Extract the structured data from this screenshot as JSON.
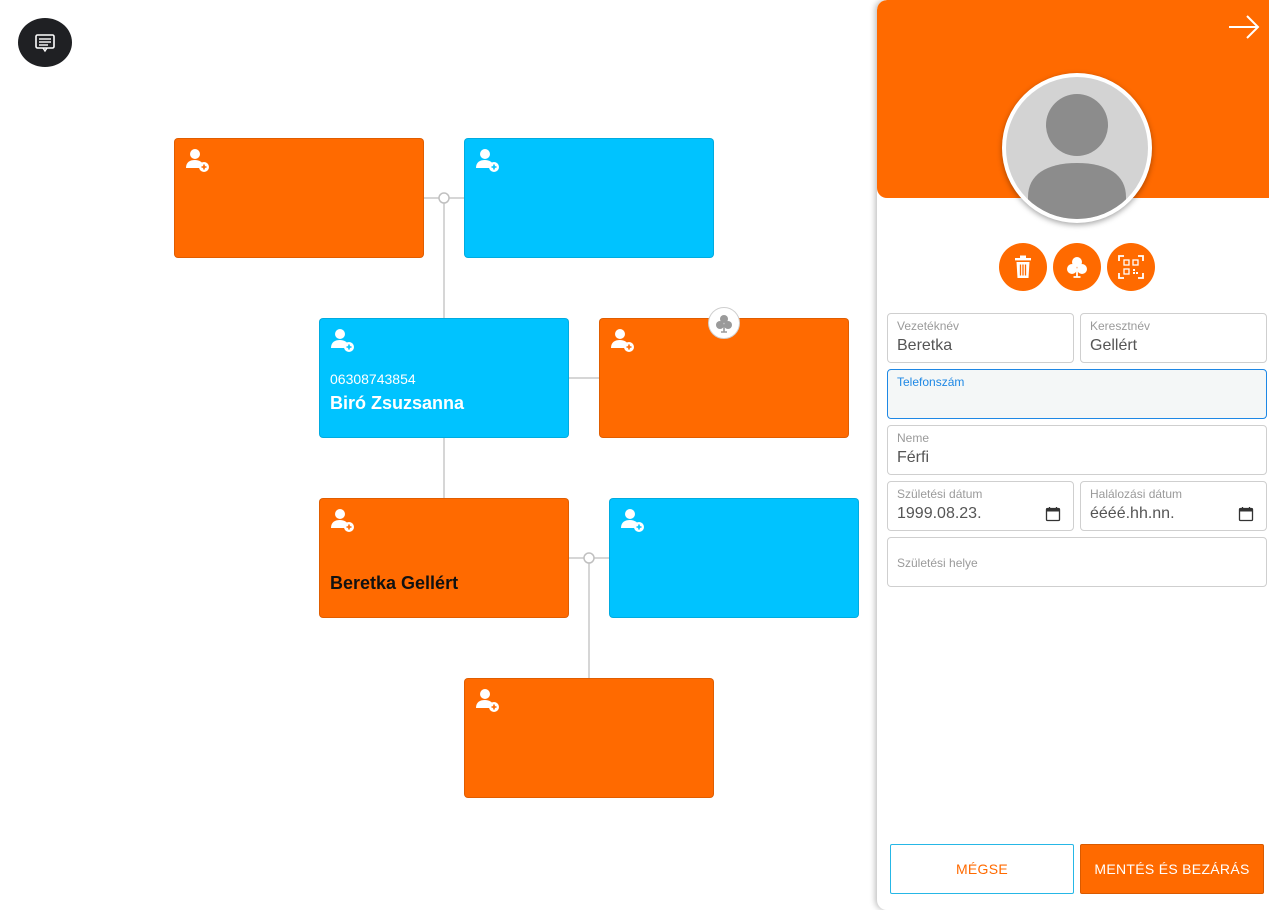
{
  "icons": {
    "menu": "notes-icon",
    "add_person": "add-person-icon",
    "clover": "clover-icon",
    "close": "arrow-right-icon",
    "delete": "trash-icon",
    "qr": "qr-scan-icon",
    "calendar": "calendar-icon"
  },
  "colors": {
    "orange": "#ff6a00",
    "blue": "#00c3ff"
  },
  "tree": {
    "cards": [
      {
        "id": "top-left",
        "color": "orange",
        "phone": "",
        "name": ""
      },
      {
        "id": "top-right",
        "color": "blue",
        "phone": "",
        "name": ""
      },
      {
        "id": "mid-left",
        "color": "blue",
        "phone": "06308743854",
        "name": "Biró Zsuzsanna"
      },
      {
        "id": "mid-right",
        "color": "orange",
        "phone": "",
        "name": ""
      },
      {
        "id": "lower-left",
        "color": "orange",
        "phone": "",
        "name": "Beretka Gellért"
      },
      {
        "id": "lower-right",
        "color": "blue",
        "phone": "",
        "name": ""
      },
      {
        "id": "bottom",
        "color": "orange",
        "phone": "",
        "name": ""
      }
    ]
  },
  "panel": {
    "fields": {
      "last_name": {
        "label": "Vezetéknév",
        "value": "Beretka"
      },
      "first_name": {
        "label": "Keresztnév",
        "value": "Gellért"
      },
      "phone": {
        "label": "Telefonszám",
        "value": ""
      },
      "gender": {
        "label": "Neme",
        "value": "Férfi"
      },
      "birth_date": {
        "label": "Születési dátum",
        "value": "1999.08.23."
      },
      "death_date": {
        "label": "Halálozási dátum",
        "value": "éééé.hh.nn."
      },
      "birth_place": {
        "label": "Születési helye",
        "value": ""
      }
    },
    "buttons": {
      "cancel": "MÉGSE",
      "save": "MENTÉS ÉS BEZÁRÁS"
    }
  }
}
